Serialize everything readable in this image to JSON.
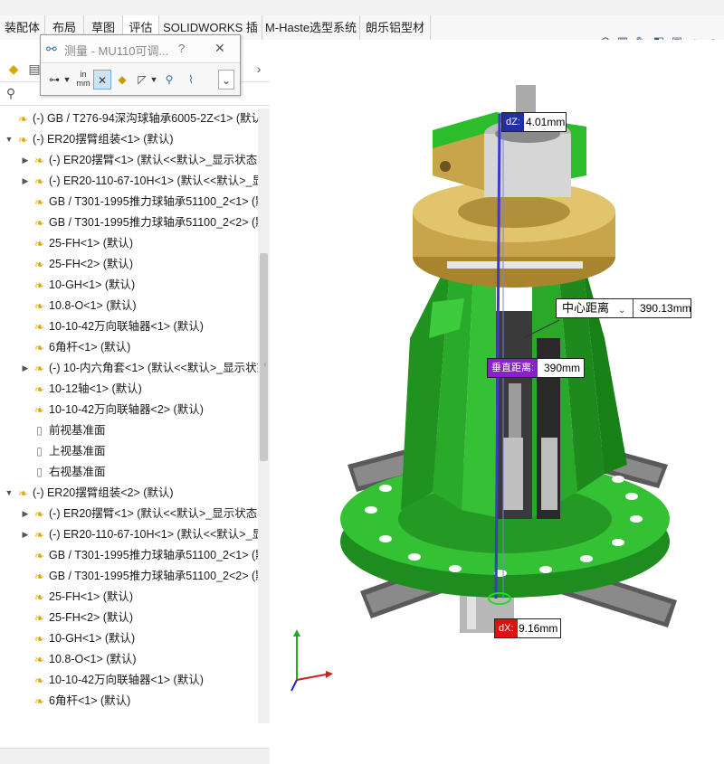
{
  "tabs": [
    "装配体",
    "布局",
    "草图",
    "评估",
    "SOLIDWORKS 插件",
    "M-Haste选型系统",
    "朗乐铝型材"
  ],
  "active_tab": "评估",
  "measure_dialog": {
    "title": "测量 - MU110可调...",
    "help": "?",
    "close": "✕",
    "units_top": "in",
    "units_bottom": "mm",
    "more": "⌄"
  },
  "tree": {
    "rows": [
      {
        "indent": 0,
        "twisty": "",
        "icon": "part",
        "label": "(-) GB / T276-94深沟球轴承6005-2Z<1> (默认"
      },
      {
        "indent": 0,
        "twisty": "▼",
        "icon": "asm",
        "label": "(-) ER20摆臂组装<1> (默认)"
      },
      {
        "indent": 1,
        "twisty": "▶",
        "icon": "part",
        "label": "(-) ER20摆臂<1> (默认<<默认>_显示状态 1"
      },
      {
        "indent": 1,
        "twisty": "▶",
        "icon": "part",
        "label": "(-) ER20-110-67-10H<1> (默认<<默认>_显"
      },
      {
        "indent": 1,
        "twisty": "",
        "icon": "part",
        "label": "GB / T301-1995推力球轴承51100_2<1> (默"
      },
      {
        "indent": 1,
        "twisty": "",
        "icon": "part",
        "label": "GB / T301-1995推力球轴承51100_2<2> (默"
      },
      {
        "indent": 1,
        "twisty": "",
        "icon": "part",
        "label": "25-FH<1> (默认)"
      },
      {
        "indent": 1,
        "twisty": "",
        "icon": "part",
        "label": "25-FH<2> (默认)"
      },
      {
        "indent": 1,
        "twisty": "",
        "icon": "part",
        "label": "10-GH<1> (默认)"
      },
      {
        "indent": 1,
        "twisty": "",
        "icon": "part",
        "label": "10.8-O<1> (默认)"
      },
      {
        "indent": 1,
        "twisty": "",
        "icon": "part",
        "label": "10-10-42万向联轴器<1> (默认)"
      },
      {
        "indent": 1,
        "twisty": "",
        "icon": "part",
        "label": "6角杆<1> (默认)"
      },
      {
        "indent": 1,
        "twisty": "▶",
        "icon": "part",
        "label": "(-) 10-内六角套<1> (默认<<默认>_显示状态"
      },
      {
        "indent": 1,
        "twisty": "",
        "icon": "part",
        "label": "10-12轴<1> (默认)"
      },
      {
        "indent": 1,
        "twisty": "",
        "icon": "part",
        "label": "10-10-42万向联轴器<2> (默认)"
      },
      {
        "indent": 1,
        "twisty": "",
        "icon": "plane",
        "label": "前视基准面"
      },
      {
        "indent": 1,
        "twisty": "",
        "icon": "plane",
        "label": "上视基准面"
      },
      {
        "indent": 1,
        "twisty": "",
        "icon": "plane",
        "label": "右视基准面"
      },
      {
        "indent": 0,
        "twisty": "▼",
        "icon": "asm",
        "label": "(-) ER20摆臂组装<2> (默认)"
      },
      {
        "indent": 1,
        "twisty": "▶",
        "icon": "part",
        "label": "(-) ER20摆臂<1> (默认<<默认>_显示状态 1"
      },
      {
        "indent": 1,
        "twisty": "▶",
        "icon": "part",
        "label": "(-) ER20-110-67-10H<1> (默认<<默认>_显"
      },
      {
        "indent": 1,
        "twisty": "",
        "icon": "part",
        "label": "GB / T301-1995推力球轴承51100_2<1> (默"
      },
      {
        "indent": 1,
        "twisty": "",
        "icon": "part",
        "label": "GB / T301-1995推力球轴承51100_2<2> (默"
      },
      {
        "indent": 1,
        "twisty": "",
        "icon": "part",
        "label": "25-FH<1> (默认)"
      },
      {
        "indent": 1,
        "twisty": "",
        "icon": "part",
        "label": "25-FH<2> (默认)"
      },
      {
        "indent": 1,
        "twisty": "",
        "icon": "part",
        "label": "10-GH<1> (默认)"
      },
      {
        "indent": 1,
        "twisty": "",
        "icon": "part",
        "label": "10.8-O<1> (默认)"
      },
      {
        "indent": 1,
        "twisty": "",
        "icon": "part",
        "label": "10-10-42万向联轴器<1> (默认)"
      },
      {
        "indent": 1,
        "twisty": "",
        "icon": "part",
        "label": "6角杆<1> (默认)"
      }
    ]
  },
  "callouts": {
    "dz_label": "dZ:",
    "dz_value": "4.01mm",
    "center_label": "中心距离",
    "center_value": "390.13mm",
    "vertical_label": "垂直距离:",
    "vertical_value": "390mm",
    "dx_label": "dX:",
    "dx_value": "9.16mm"
  },
  "colors": {
    "model_green": "#2fbf2f",
    "model_dark_green": "#1f8f1f",
    "brass": "#c8a44a",
    "measure_line": "#4040c0",
    "dz_label_bg": "#2030a0",
    "vertical_label_bg": "#8a20c8",
    "dx_label_bg": "#e01010"
  }
}
